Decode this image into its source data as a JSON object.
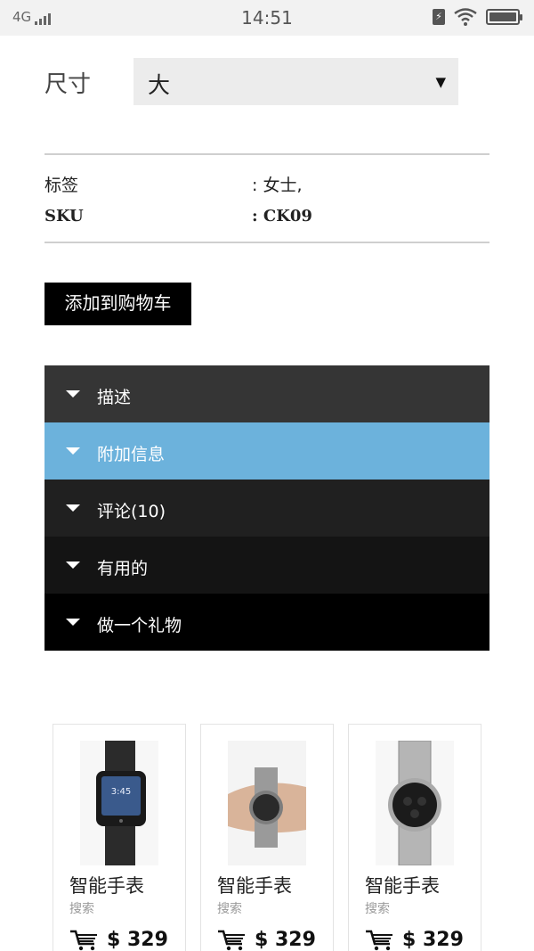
{
  "status_bar": {
    "network": "4G",
    "time": "14:51"
  },
  "product": {
    "size_label": "尺寸",
    "size_value": "大",
    "meta": [
      {
        "key": "标签",
        "value": ": 女士,"
      },
      {
        "key": "SKU",
        "value": ": CK09"
      }
    ],
    "add_to_cart_label": "添加到购物车"
  },
  "accordion": [
    {
      "label": "描述",
      "bg": "#353535"
    },
    {
      "label": "附加信息",
      "bg": "#6cb2dc"
    },
    {
      "label": "评论(10)",
      "bg": "#202020"
    },
    {
      "label": "有用的",
      "bg": "#141414"
    },
    {
      "label": "做一个礼物",
      "bg": "#000000"
    }
  ],
  "related_products": [
    {
      "name": "智能手表",
      "sub": "搜索",
      "price": "$ 329",
      "icon": "smartwatch-image"
    },
    {
      "name": "智能手表",
      "sub": "搜索",
      "price": "$ 329",
      "icon": "wristwatch-on-wrist-image"
    },
    {
      "name": "智能手表",
      "sub": "搜索",
      "price": "$ 329",
      "icon": "chronograph-watch-image"
    }
  ],
  "colors": {
    "accent": "#6cb2dc",
    "button": "#000000"
  }
}
